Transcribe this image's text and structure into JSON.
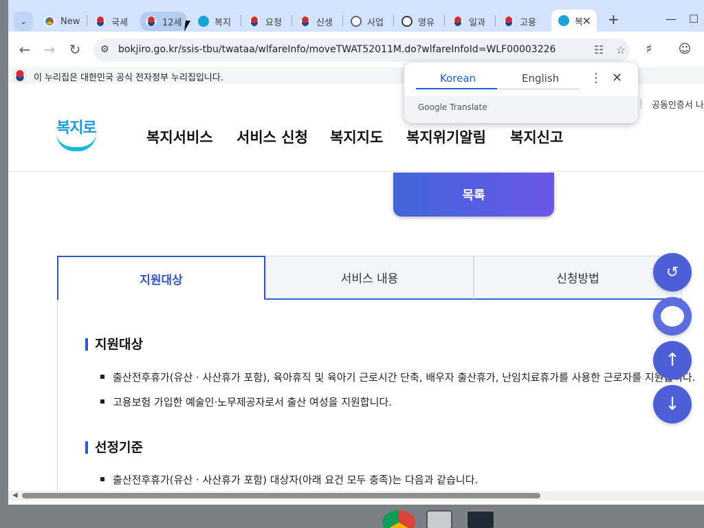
{
  "tabs": [
    {
      "label": "New",
      "icon": "chrome-icon"
    },
    {
      "label": "국세",
      "icon": "korea-gov-icon"
    },
    {
      "label": "12세",
      "icon": "korea-gov-icon"
    },
    {
      "label": "복지",
      "icon": "bokjiro-icon"
    },
    {
      "label": "요청",
      "icon": "korea-gov-icon"
    },
    {
      "label": "신생",
      "icon": "korea-gov-icon"
    },
    {
      "label": "사업",
      "icon": "globe-icon"
    },
    {
      "label": "영유",
      "icon": "site-icon"
    },
    {
      "label": "일과",
      "icon": "korea-gov-icon"
    },
    {
      "label": "고용",
      "icon": "korea-gov-icon"
    },
    {
      "label": "복",
      "icon": "bokjiro-icon"
    }
  ],
  "address": {
    "url": "bokjiro.go.kr/ssis-tbu/twataa/wlfareInfo/moveTWAT52011M.do?wlfareInfoId=WLF00003226"
  },
  "gov_banner": "이 누리집은 대한민국 공식 전자정부 누리집입니다.",
  "site": {
    "logo_text": "복지로",
    "nav": [
      "복지서비스",
      "서비스 신청",
      "복지지도",
      "복지위기알림",
      "복지신고"
    ],
    "cert_link": "공동인증서 나"
  },
  "content": {
    "list_button": "목록",
    "tabs": [
      "지원대상",
      "서비스 내용",
      "신청방법"
    ],
    "sections": [
      {
        "title": "지원대상",
        "items": [
          "출산전후휴가(유산 · 사산휴가 포함), 육아휴직 및 육아기 근로시간 단축, 배우자 출산휴가, 난임치료휴가를 사용한 근로자를 지원합니다.",
          "고용보험 가입한 예술인·노무제공자로서 출산 여성을 지원합니다."
        ]
      },
      {
        "title": "선정기준",
        "items": [
          "출산전후휴가(유산 · 사산휴가 포함) 대상자(아래 요건 모두 충족)는 다음과 같습니다."
        ]
      }
    ]
  },
  "translate_popup": {
    "source_lang": "Korean",
    "target_lang": "English",
    "footer": "Google Translate"
  },
  "colors": {
    "accent": "#2f55c8",
    "list_button_start": "#4165d9",
    "list_button_end": "#6a58e6",
    "tabstrip": "#d3e3fd"
  }
}
